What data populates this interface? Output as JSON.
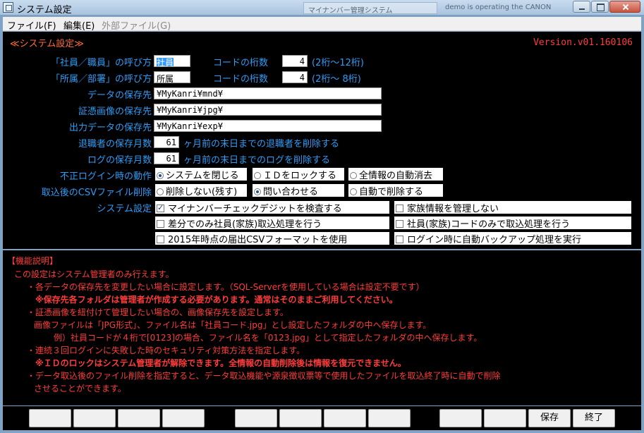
{
  "window": {
    "title": "システム設定",
    "bg_tab_1": "マイナンバー管理システム",
    "bg_tab_2": "demo is operating the CANON"
  },
  "menu": [
    {
      "label": "ファイル(F)",
      "enabled": true
    },
    {
      "label": "編集(E)",
      "enabled": true
    },
    {
      "label": "外部ファイル(G)",
      "enabled": false
    }
  ],
  "settings": {
    "section_title": "≪システム設定≫",
    "version": "Version.v01.160106",
    "employee_name_label": "「社員／職員」の呼び方",
    "employee_name_value": "社員",
    "employee_code_label": "コードの桁数",
    "employee_code_digits": "4",
    "employee_code_range": "(2桁〜12桁)",
    "dept_name_label": "「所属／部署」の呼び方",
    "dept_name_value": "所属",
    "dept_code_label": "コードの桁数",
    "dept_code_digits": "4",
    "dept_code_range": "(2桁〜 8桁)",
    "data_path_label": "データの保存先",
    "data_path": "¥MyKanri¥mnd¥",
    "image_path_label": "証憑画像の保存先",
    "image_path": "¥MyKanri¥jpg¥",
    "export_path_label": "出力データの保存先",
    "export_path": "¥MyKanri¥exp¥",
    "retire_months_label": "退職者の保存月数",
    "retire_months": "61",
    "retire_months_suffix": "ヶ月前の末日までの退職者を削除する",
    "log_months_label": "ログの保存月数",
    "log_months": "61",
    "log_months_suffix": "ヶ月前の末日までのログを削除する",
    "invalid_login_label": "不正ログイン時の動作",
    "invalid_login_options": [
      {
        "label": "システムを閉じる",
        "selected": true
      },
      {
        "label": "ＩＤをロックする",
        "selected": false
      },
      {
        "label": "全情報の自動消去",
        "selected": false
      }
    ],
    "csv_delete_label": "取込後のCSVファイル削除",
    "csv_delete_options": [
      {
        "label": "削除しない(残す)",
        "selected": false
      },
      {
        "label": "問い合わせる",
        "selected": true
      },
      {
        "label": "自動で削除する",
        "selected": false
      }
    ],
    "system_label": "システム設定",
    "checkboxes": [
      {
        "label": "マイナンバーチェックデジットを検査する",
        "checked": true
      },
      {
        "label": "家族情報を管理しない",
        "checked": false
      },
      {
        "label": "差分でのみ社員(家族)取込処理を行う",
        "checked": false
      },
      {
        "label": "社員(家族)コードのみで取込処理を行う",
        "checked": false
      },
      {
        "label": "2015年時点の届出CSVフォーマットを使用",
        "checked": false
      },
      {
        "label": "ログイン時に自動バックアップ処理を実行",
        "checked": false
      }
    ]
  },
  "description": {
    "heading": "【機能説明】",
    "lines": [
      "この設定はシステム管理者のみ行えます。",
      "・各データの保存先を変更したい場合に設定します。（SQL-Serverを使用している場合は設定不要です）",
      "※保存先各フォルダは管理者が作成する必要があります。通常はそのままご利用してください。",
      "・証憑画像を紐付けて管理したい場合の、画像保存先を設定します。",
      "画像ファイルは「JPG形式」、ファイル名は「社員コード.jpg」とし設定したフォルダの中へ保存します。",
      "例）社員コードが４桁で[0123]の場合、ファイル名を「0123.jpg」として指定したフォルダの中へ保存します。",
      "・連続３回ログインに失敗した時のセキュリティ対策方法を指定します。",
      "※ＩＤのロックはシステム管理者が解除できます。全情報の自動削除後は情報を復元できません。",
      "・データ取込後のファイル削除を指定すると、データ取込機能や源泉徴収票等で使用したファイルを取込終了時に自動で削除",
      "させることができます。"
    ]
  },
  "footer": {
    "save_label": "保存",
    "exit_label": "終了"
  }
}
